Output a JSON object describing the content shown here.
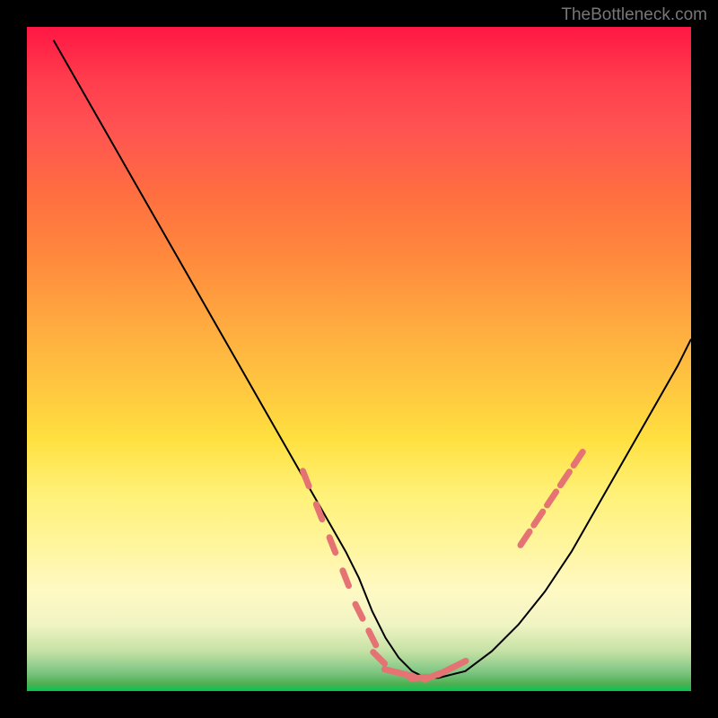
{
  "watermark": "TheBottleneck.com",
  "chart_data": {
    "type": "line",
    "title": "",
    "xlabel": "",
    "ylabel": "",
    "xlim": [
      0,
      100
    ],
    "ylim": [
      0,
      100
    ],
    "grid": false,
    "series": [
      {
        "name": "bottleneck-curve",
        "type": "line",
        "color": "#000000",
        "x": [
          4,
          8,
          12,
          16,
          20,
          24,
          28,
          32,
          36,
          40,
          44,
          48,
          50,
          52,
          54,
          56,
          58,
          60,
          62,
          66,
          70,
          74,
          78,
          82,
          86,
          90,
          94,
          98,
          100
        ],
        "y": [
          98,
          91,
          84,
          77,
          70,
          63,
          56,
          49,
          42,
          35,
          28,
          21,
          17,
          12,
          8,
          5,
          3,
          2,
          2,
          3,
          6,
          10,
          15,
          21,
          28,
          35,
          42,
          49,
          53
        ]
      },
      {
        "name": "highlight-left-descent",
        "type": "dashed-marker",
        "color": "#e57373",
        "x": [
          42,
          44,
          46,
          48,
          50,
          52
        ],
        "y": [
          32,
          27,
          22,
          17,
          12,
          8
        ]
      },
      {
        "name": "highlight-valley",
        "type": "dashed-marker",
        "color": "#e57373",
        "x": [
          53,
          55,
          57,
          59,
          61,
          63,
          65
        ],
        "y": [
          5,
          3,
          2.5,
          2,
          2.2,
          3,
          4
        ]
      },
      {
        "name": "highlight-right-ascent",
        "type": "dashed-marker",
        "color": "#e57373",
        "x": [
          75,
          77,
          79,
          81,
          83
        ],
        "y": [
          23,
          26,
          29,
          32,
          35
        ]
      }
    ],
    "background_gradient": {
      "type": "vertical",
      "stops": [
        {
          "pos": 0,
          "color": "#ff1744"
        },
        {
          "pos": 0.5,
          "color": "#ffc940"
        },
        {
          "pos": 0.85,
          "color": "#fff9c4"
        },
        {
          "pos": 1.0,
          "color": "#00c853"
        }
      ]
    }
  }
}
